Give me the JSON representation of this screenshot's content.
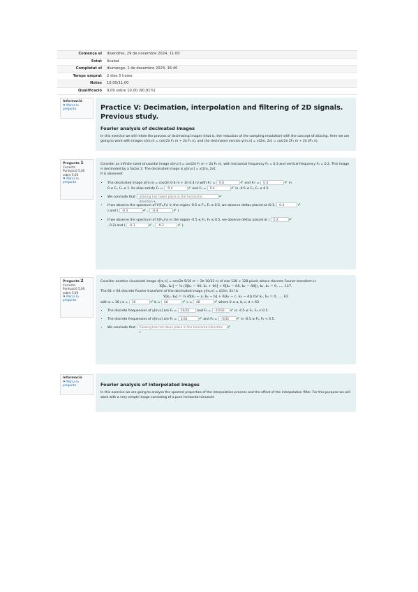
{
  "summary": [
    {
      "key": "Comença el",
      "value": "divendres, 29 de novembre 2024, 11:00"
    },
    {
      "key": "Estat",
      "value": "Acabat"
    },
    {
      "key": "Completat el",
      "value": "diumenge, 1 de desembre 2024, 16:40"
    },
    {
      "key": "Temps emprat",
      "value": "2 dies 5 hores"
    },
    {
      "key": "Notes",
      "value": "10,00/11,00"
    },
    {
      "key": "Qualificació",
      "value": "9,09 sobre 10,00 (90,91%)"
    }
  ],
  "info1": {
    "title": "Informació",
    "link": "Marca la pregunta"
  },
  "q1": {
    "label": "Pregunta",
    "num": "1",
    "status": "Correcta",
    "points": "Puntuació 5,00 sobre 5,00",
    "flag": "Marca la pregunta"
  },
  "q2": {
    "label": "Pregunta",
    "num": "2",
    "status": "Correcta",
    "points": "Puntuació 5,00 sobre 5,00",
    "flag": "Marca la pregunta"
  },
  "info2": {
    "title": "Informació",
    "link": "Marca la pregunta"
  },
  "card1": {
    "title": "Practice V: Decimation, interpolation and filtering of 2D signals. Previous study.",
    "subtitle": "Fourier analysis of decimated images",
    "text": "In this exercise we will relate the process of decimating images (that is, the reduction of the sampling resolution) with the concept of aliasing. Here we are going to work with images x[m,n] = cos(2π F₁ m + 2π F₂ n), and the decimated version y[m,n] = x[2m, 2n] = cos(2π 2F₁ m + 2π 2F₂ n)."
  },
  "q1c": {
    "intro": "Consider an infinite sized sinusoidal image x[m,n] = cos(2π F₁ m + 2π F₂ n), with horizontal frequency F₁ = 0.3 and vertical frequency F₂ = 0.2. This image is decimated by a factor 2. The decimated image is y[m,n] = x[2m, 2n].",
    "then": "It is observed:",
    "b1a": "The decimated image y[m,n] = cos(2π 0.6 m + 2π 0.4 n) with F₁' =",
    "b1_v1": "0.6",
    "b1b": "and F₂' =",
    "b1_v2": "0.4",
    "b1c": "in",
    "b1d": "0 ≤ F₁, F₂ ≤ 1. Its alias satisfy F₁ =",
    "b1_v3": "-0.4",
    "b1e": "and F₂ =",
    "b1_v4": "0.4",
    "b1f": "in -0.5 ≤ F₁, F₂ ≤ 0.5",
    "b2a": "We conclude that",
    "b2_sel": "aliasing has taken place in the horizontal direction",
    "b3a": "If we observe the spectrum of Y(F₁,F₂) in the region -0.5 ≤ F₁, F₂ ≤ 0.5, we observe deltas placed at (0.3,",
    "b3_v1": "0.4",
    "b3b": ") and (",
    "b3_v2": "-0.3",
    "b3c": ",",
    "b3_v3": "-0.4",
    "b3d": ")",
    "b4a": "If we observe the spectrum of X(F₁,F₂) in the region -0.5 ≤ F₁, F₂ ≤ 0.5, we observe deltas placed at (",
    "b4_v1": "0.3",
    "b4b": ", 0.2) and (",
    "b4_v2": "-0.3",
    "b4c": ",",
    "b4_v3": "-0.2",
    "b4d": ")."
  },
  "q2c": {
    "intro": "Consider another sinusoidal image x[m,n] = cos(2π 5/16 m − 2π 10/32 n) of size 128 × 128 pixels whose discrete Fourier transform is",
    "eq1": "X[k₁, k₂] = ¼ (δ[k₁ − 40, k₂ + 40] + δ[k₁ − 88, k₂ − 88]),  k₁, k₂ = 0, ..., 127.",
    "mid": "The 64 × 64 discrete Fourier transform of the decimated image y[m,n] = x[2m, 2n] is",
    "eq2": "Y[k₁, k₂] = ¼ (δ[k₁ − a, k₂ − b] + δ[k₁ − c, k₂ − d]) for k₁, k₂ = 0, ..., 63",
    "withA": "with a = 16 / a =",
    "va": "16",
    "withB": "b =",
    "vb": "48",
    "withC": "c =",
    "vc": "48",
    "withD": "where 0 ≤ a, b, c, d < 63",
    "l1a": "The discrete frequencies of y[m,n] are F₁ =",
    "l1_v1": "10/32",
    "l1b": "and F₂ =",
    "l1_v2": "-10/32",
    "l1c": "in -0.5 ≤ F₁, F₂ < 0.5.",
    "l2a": "The discrete frequencies of x[m,n] are F₁ =",
    "l2_v1": "5/32",
    "l2b": "and F₂ =",
    "l2_v2": "-5/32",
    "l2c": "in -0.5 ≤ F₁, F₂ < 0.5.",
    "l3a": "We conclude that",
    "l3_sel": "Aliasing has not taken place in the horizontal direction"
  },
  "card2": {
    "subtitle": "Fourier analysis of interpolated images",
    "text": "In this exercise we are going to analyse the spectral properties of the interpolation process and the effect of the interpolation filter. For this purpose we will work with a very simple image consisting of a pure horizontal sinusoid."
  },
  "colors": {
    "card_bg": "#e6f1f3",
    "check": "#3a9a3a",
    "link": "#0f6cbf"
  }
}
